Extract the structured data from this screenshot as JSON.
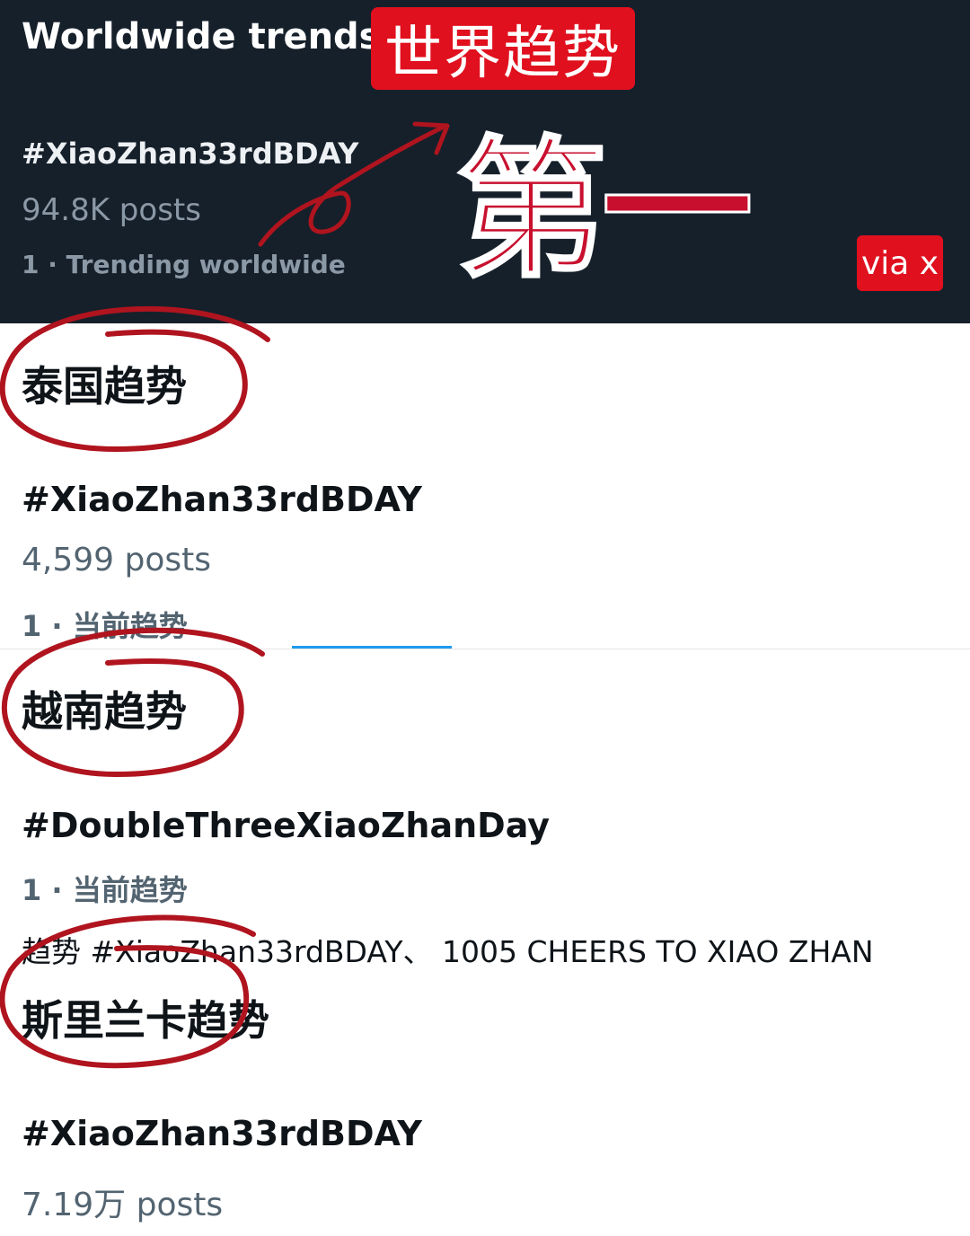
{
  "worldwide": {
    "title": "Worldwide trends",
    "badge": "世界趋势",
    "hashtag": "#XiaoZhan33rdBDAY",
    "posts": "94.8K posts",
    "rank": "1 · Trending worldwide",
    "callout": "第一",
    "via": "via x"
  },
  "sections": [
    {
      "heading": "泰国趋势",
      "hashtag": "#XiaoZhan33rdBDAY",
      "posts": "4,599 posts",
      "rank": "1 · 当前趋势"
    },
    {
      "heading": "越南趋势",
      "hashtag": "#DoubleThreeXiaoZhanDay",
      "rank": "1 · 当前趋势",
      "related": "趋势 #XiaoZhan33rdBDAY、 1005 CHEERS TO XIAO ZHAN"
    },
    {
      "heading": "斯里兰卡趋势",
      "hashtag": "#XiaoZhan33rdBDAY",
      "posts": "7.19万 posts"
    }
  ],
  "colors": {
    "dark_bg": "#16202b",
    "badge_red": "#e0101e",
    "annotation_red": "#b0141e",
    "accent_blue": "#1d9bf0"
  }
}
